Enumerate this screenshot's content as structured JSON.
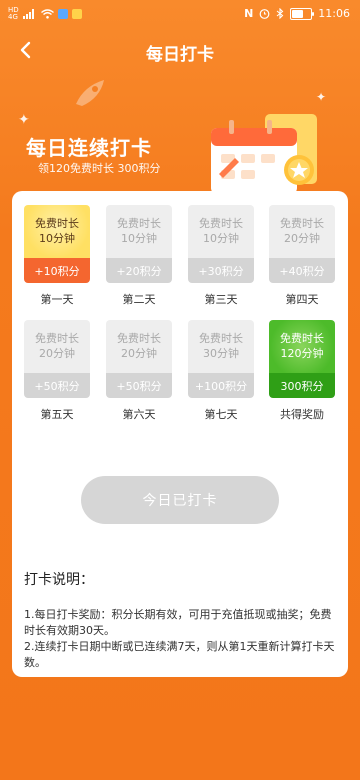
{
  "status_bar": {
    "left_icons": [
      "hd-signal-icon",
      "cellular-signal-icon",
      "wifi-icon",
      "app-notification-icon",
      "chat-notification-icon"
    ],
    "right_icons": [
      "nfc-icon",
      "alarm-icon",
      "bluetooth-icon",
      "battery-icon"
    ],
    "time": "11:06",
    "battery_level": 0.6
  },
  "header": {
    "title": "每日打卡"
  },
  "hero": {
    "headline": "每日连续打卡",
    "subtitle": "领120免费时长 300积分"
  },
  "days": [
    {
      "reward_text": "免费时长\n10分钟",
      "points": "+10积分",
      "label": "第一天",
      "state": "active"
    },
    {
      "reward_text": "免费时长\n10分钟",
      "points": "+20积分",
      "label": "第二天",
      "state": "pending"
    },
    {
      "reward_text": "免费时长\n10分钟",
      "points": "+30积分",
      "label": "第三天",
      "state": "pending"
    },
    {
      "reward_text": "免费时长\n20分钟",
      "points": "+40积分",
      "label": "第四天",
      "state": "pending"
    },
    {
      "reward_text": "免费时长\n20分钟",
      "points": "+50积分",
      "label": "第五天",
      "state": "pending"
    },
    {
      "reward_text": "免费时长\n20分钟",
      "points": "+50积分",
      "label": "第六天",
      "state": "pending"
    },
    {
      "reward_text": "免费时长\n30分钟",
      "points": "+100积分",
      "label": "第七天",
      "state": "pending"
    },
    {
      "reward_text": "免费时长\n120分钟",
      "points": "300积分",
      "label": "共得奖励",
      "state": "reward"
    }
  ],
  "checkin_button": {
    "label": "今日已打卡"
  },
  "rules": {
    "title": "打卡说明：",
    "lines": [
      "1.每日打卡奖励：积分长期有效，可用于充值抵现或抽奖；免费时长有效期30天。",
      "2.连续打卡日期中断或已连续满7天，则从第1天重新计算打卡天数。"
    ]
  },
  "colors": {
    "background": "#f47a1d",
    "active_points": "#f4662f",
    "reward_green": "#4dbb2a",
    "disabled_button": "#d6d6d6"
  }
}
